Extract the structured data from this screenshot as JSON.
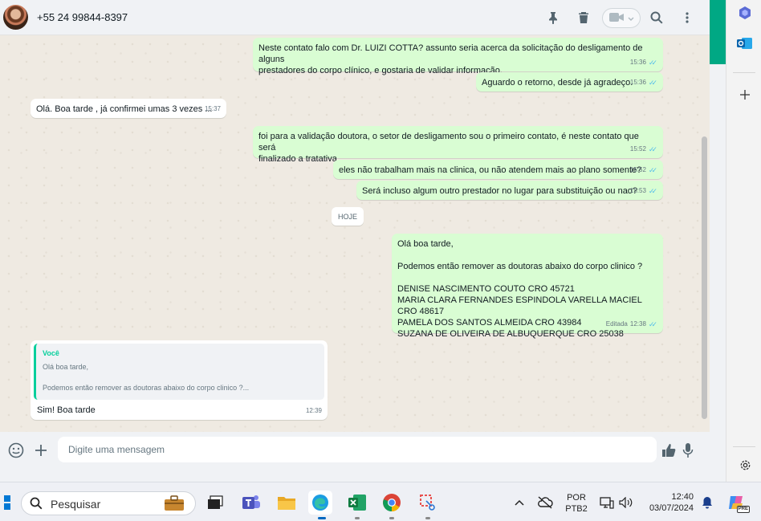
{
  "window": {
    "contact_name": "+55 24 99844-8397"
  },
  "messages": [
    {
      "id": "m1",
      "dir": "out",
      "text": "Neste contato falo com Dr. LUIZI COTTA? assunto seria acerca da solicitação do desligamento de alguns\nprestadores do corpo clínico, e gostaria de validar informação.",
      "time": "15:36",
      "read": true
    },
    {
      "id": "m2",
      "dir": "out",
      "text": "Aguardo o retorno, desde já agradeço.",
      "time": "15:36",
      "read": true
    },
    {
      "id": "m3",
      "dir": "in",
      "text": "Olá. Boa tarde , já confirmei umas 3 vezes ...",
      "time": "15:37"
    },
    {
      "id": "m4",
      "dir": "out",
      "text": "foi para a validação doutora, o setor de desligamento sou o primeiro contato, é neste contato que será\nfinalizado a tratativa.",
      "time": "15:52",
      "read": true
    },
    {
      "id": "m5",
      "dir": "out",
      "text": "eles não trabalham mais na clinica, ou não atendem mais ao plano somente?",
      "time": "15:52",
      "read": true
    },
    {
      "id": "m6",
      "dir": "out",
      "text": "Será incluso algum outro prestador no lugar para substituição ou nao?",
      "time": "15:53",
      "read": true
    },
    {
      "id": "m7",
      "dir": "out",
      "text": "Olá boa tarde,\n\nPodemos então remover as doutoras abaixo do corpo clinico ?\n\nDENISE NASCIMENTO COUTO CRO 45721\nMARIA CLARA FERNANDES ESPINDOLA VARELLA MACIEL CRO 48617\nPAMELA DOS SANTOS ALMEIDA CRO 43984\nSUZANA DE OLIVEIRA DE ALBUQUERQUE CRO 25038",
      "time": "12:38",
      "edited": "Editada",
      "read": true
    },
    {
      "id": "m8",
      "dir": "in",
      "text": "Sim! Boa tarde",
      "time": "12:39",
      "quote": {
        "author": "Você",
        "text": "Olá boa tarde,\n\nPodemos então remover as doutoras abaixo do corpo clinico ?..."
      }
    }
  ],
  "date_divider": "HOJE",
  "composer": {
    "placeholder": "Digite uma mensagem"
  },
  "taskbar": {
    "search_label": "Pesquisar",
    "lang_line1": "POR",
    "lang_line2": "PTB2",
    "clock_time": "12:40",
    "clock_date": "03/07/2024",
    "copilot_badge": "PRE"
  },
  "colors": {
    "accent": "#00a884",
    "bubble_out": "#d9fdd3",
    "bubble_in": "#ffffff",
    "read_ticks": "#53bdeb"
  }
}
